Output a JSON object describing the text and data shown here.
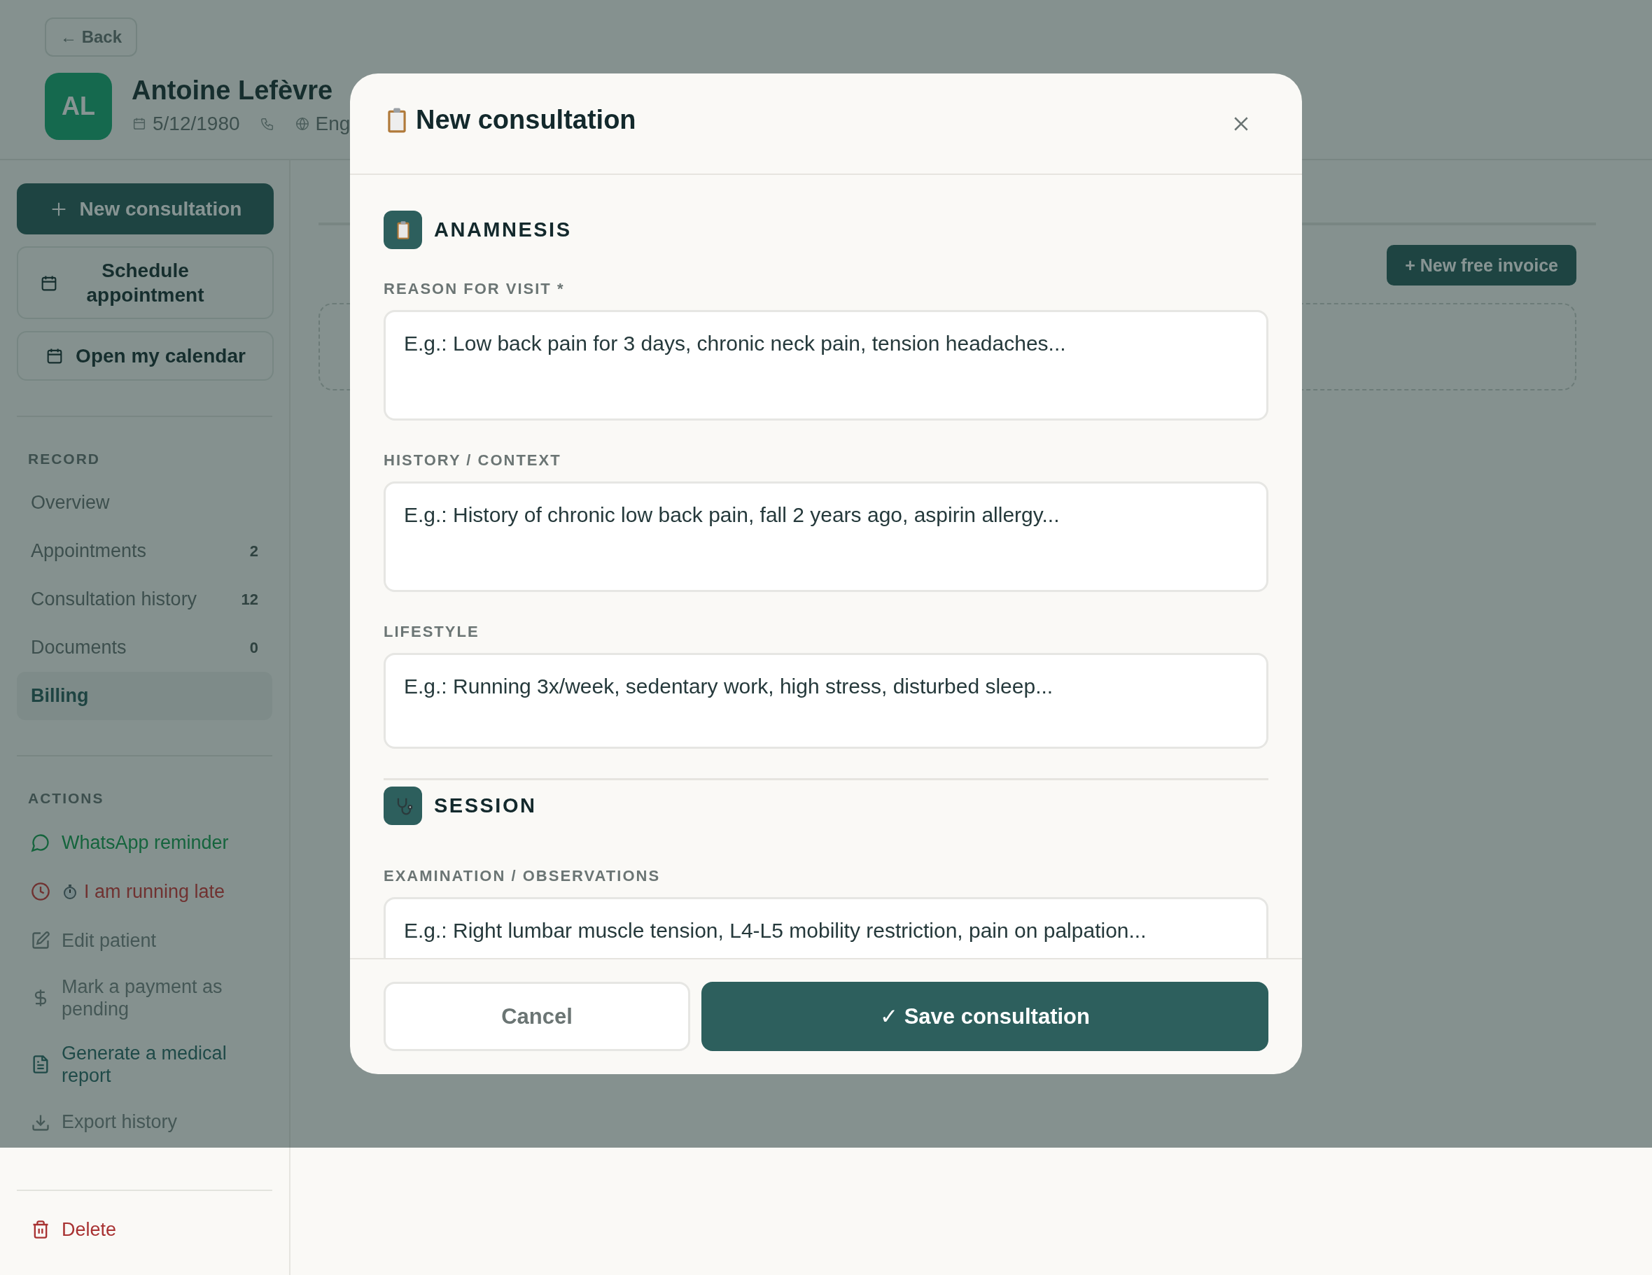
{
  "header": {
    "back_label": "← Back",
    "avatar_initials": "AL",
    "patient_name": "Antoine Lefèvre",
    "birth_date": "5/12/1980",
    "language": "Eng"
  },
  "sidebar": {
    "buttons": [
      {
        "kind": "primary",
        "label": "New consultation"
      },
      {
        "kind": "schedule",
        "label": "Schedule appointment"
      },
      {
        "kind": "calendar",
        "label": "Open my calendar"
      }
    ],
    "record_heading": "RECORD",
    "record_items": [
      {
        "label": "Overview",
        "selected": false
      },
      {
        "label": "Appointments",
        "count": "2",
        "selected": false
      },
      {
        "label": "Consultation history",
        "count": "12",
        "selected": false
      },
      {
        "label": "Documents",
        "count": "0",
        "selected": false
      },
      {
        "label": "Billing",
        "selected": true
      }
    ],
    "actions_heading": "ACTIONS",
    "actions": [
      {
        "kind": "chat",
        "label": "WhatsApp reminder"
      },
      {
        "kind": "late",
        "label": "I am running late"
      },
      {
        "kind": "edit",
        "label": "Edit patient"
      },
      {
        "kind": "dollar",
        "label": "Mark a payment as pending"
      },
      {
        "kind": "document",
        "label": "Generate a medical report"
      },
      {
        "kind": "download",
        "label": "Export history"
      }
    ],
    "delete_label": "Delete"
  },
  "main": {
    "new_invoice_label": "+ New free invoice"
  },
  "modal": {
    "title": "New consultation",
    "sections": [
      {
        "kind": "clipboard",
        "title": "ANAMNESIS",
        "fields": [
          {
            "label": "REASON FOR VISIT *",
            "placeholder": "E.g.: Low back pain for 3 days, chronic neck pain, tension headaches..."
          },
          {
            "label": "HISTORY / CONTEXT",
            "placeholder": "E.g.: History of chronic low back pain, fall 2 years ago, aspirin allergy..."
          },
          {
            "label": "LIFESTYLE",
            "placeholder": "E.g.: Running 3x/week, sedentary work, high stress, disturbed sleep..."
          }
        ]
      },
      {
        "kind": "stethoscope",
        "title": "SESSION",
        "fields": [
          {
            "label": "EXAMINATION / OBSERVATIONS",
            "placeholder": "E.g.: Right lumbar muscle tension, L4-L5 mobility restriction, pain on palpation..."
          }
        ]
      }
    ],
    "cancel_label": "Cancel",
    "save_label": "✓ Save consultation"
  }
}
